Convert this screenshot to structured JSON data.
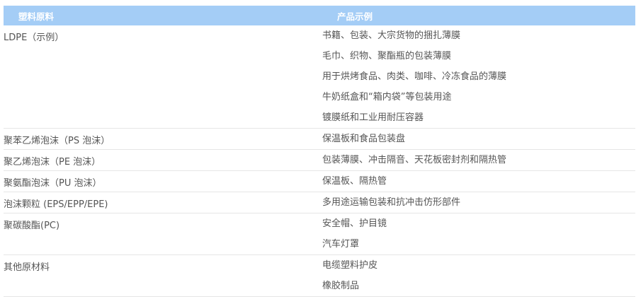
{
  "table": {
    "header": {
      "material": "塑料原料",
      "examples": "产品示例"
    },
    "rows": [
      {
        "material": "LDPE（示例）",
        "items": [
          "书籍、包装、大宗货物的捆扎薄膜",
          "毛巾、织物、聚酯瓶的包装薄膜",
          "用于烘烤食品、肉类、咖啡、冷冻食品的薄膜",
          "牛奶纸盒和“箱内袋”等包装用途",
          "镀膜纸和工业用耐压容器"
        ]
      },
      {
        "material": "聚苯乙烯泡沫（PS 泡沫）",
        "items": [
          "保温板和食品包装盘"
        ]
      },
      {
        "material": "聚乙烯泡沫（PE 泡沫）",
        "items": [
          "包装薄膜、冲击隔音、天花板密封剂和隔热管"
        ]
      },
      {
        "material": "聚氨酯泡沫（PU 泡沫）",
        "items": [
          "保温板、隔热管"
        ]
      },
      {
        "material": "泡沫颗粒 (EPS/EPP/EPE)",
        "items": [
          "多用途运输包装和抗冲击仿形部件"
        ]
      },
      {
        "material": "聚碳酸酯(PC)",
        "items": [
          "安全帽、护目镜",
          "汽车灯罩"
        ]
      },
      {
        "material": "其他原材料",
        "items": [
          "电缆塑料护皮",
          "橡胶制品"
        ]
      }
    ]
  }
}
